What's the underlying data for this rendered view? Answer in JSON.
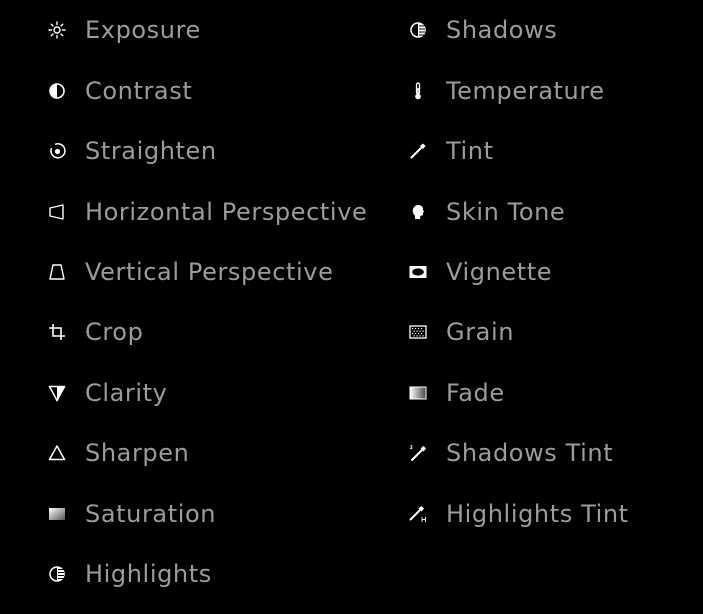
{
  "tools": {
    "left": [
      {
        "label": "Exposure",
        "icon": "sun-icon"
      },
      {
        "label": "Contrast",
        "icon": "half-circle-icon"
      },
      {
        "label": "Straighten",
        "icon": "straighten-icon"
      },
      {
        "label": "Horizontal Perspective",
        "icon": "horizontal-perspective-icon"
      },
      {
        "label": "Vertical Perspective",
        "icon": "vertical-perspective-icon"
      },
      {
        "label": "Crop",
        "icon": "crop-icon"
      },
      {
        "label": "Clarity",
        "icon": "clarity-triangle-icon"
      },
      {
        "label": "Sharpen",
        "icon": "sharpen-triangle-icon"
      },
      {
        "label": "Saturation",
        "icon": "saturation-gradient-icon"
      },
      {
        "label": "Highlights",
        "icon": "highlights-icon"
      }
    ],
    "right": [
      {
        "label": "Shadows",
        "icon": "shadows-icon"
      },
      {
        "label": "Temperature",
        "icon": "thermometer-icon"
      },
      {
        "label": "Tint",
        "icon": "eyedropper-icon"
      },
      {
        "label": "Skin Tone",
        "icon": "face-profile-icon"
      },
      {
        "label": "Vignette",
        "icon": "vignette-icon"
      },
      {
        "label": "Grain",
        "icon": "grain-icon"
      },
      {
        "label": "Fade",
        "icon": "fade-gradient-icon"
      },
      {
        "label": "Shadows Tint",
        "icon": "shadows-tint-eyedropper-icon"
      },
      {
        "label": "Highlights Tint",
        "icon": "highlights-tint-eyedropper-icon"
      }
    ]
  },
  "colors": {
    "background": "#000000",
    "label": "#9c9c9c",
    "icon": "#ffffff"
  }
}
